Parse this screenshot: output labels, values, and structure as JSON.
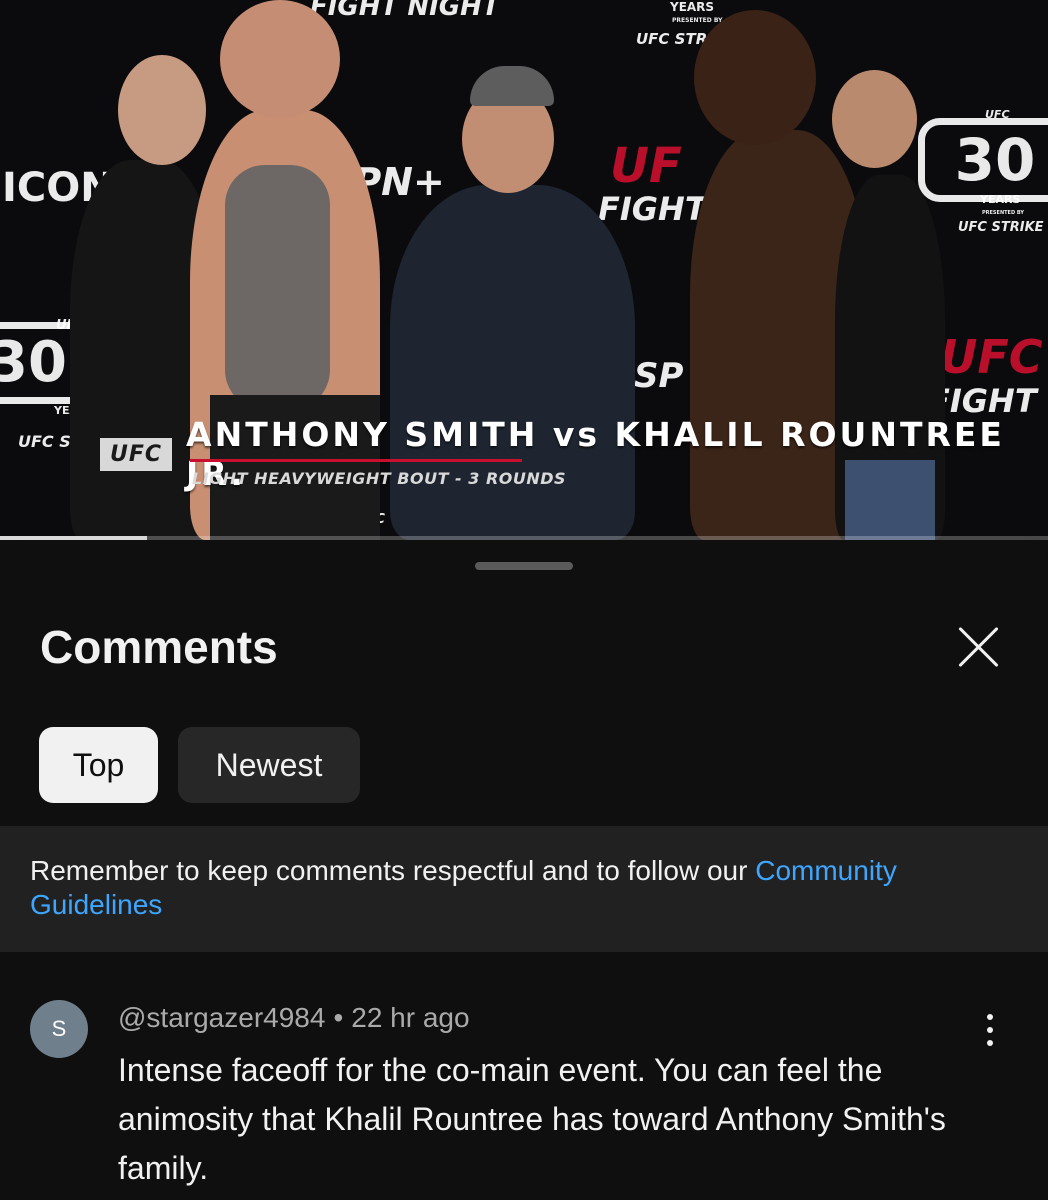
{
  "video": {
    "caption_badge": "UFC",
    "caption_title": "ANTHONY SMITH vs KHALIL ROUNTREE JR.",
    "caption_subtitle": "LIGHT HEAVYWEIGHT BOUT - 3 ROUNDS",
    "backdrop": {
      "fight_night_top": "FIGHT NIGHT",
      "years_top": "YEARS",
      "presented_by_top": "PRESENTED BY",
      "ufc_strike_top": "UFC STR",
      "icon": "ICON",
      "espn": "ESPN+",
      "ufc_fight_red": "UF",
      "fight": "FIGHT",
      "ufc_left": "UFC",
      "years_left": "YEAI",
      "ufc_strike_left": "UFC S",
      "num30": "30",
      "ufc_right_ring": "UFC",
      "years_right": "YEARS",
      "presented_by_right": "PRESENTED BY",
      "ufc_strike_right": "UFC STRIKE",
      "ufc_right_red": "UFC",
      "fight_night_right": "FIGHT NI",
      "espn_small": "SP",
      "ufc_bottom": "UFC"
    },
    "progress_fraction": 0.14,
    "colors": {
      "ufc_red": "#c8102e",
      "caption_white": "#ffffff"
    }
  },
  "comments_sheet": {
    "title": "Comments",
    "close_icon": "close-icon",
    "sort_tabs": [
      {
        "label": "Top",
        "selected": true
      },
      {
        "label": "Newest",
        "selected": false
      }
    ],
    "notice": {
      "text": "Remember to keep comments respectful and to follow our ",
      "link_text": "Community Guidelines"
    },
    "comments": [
      {
        "avatar_letter": "S",
        "author": "@stargazer4984",
        "separator": "•",
        "time": "22 hr ago",
        "text": "Intense faceoff for the co-main event. You can feel the animosity that Khalil Rountree has toward Anthony Smith's family.",
        "more_icon": "more-vertical-icon"
      }
    ],
    "colors": {
      "link": "#3ea6ff",
      "background": "#0f0f0f",
      "notice_bg": "#212121"
    }
  }
}
